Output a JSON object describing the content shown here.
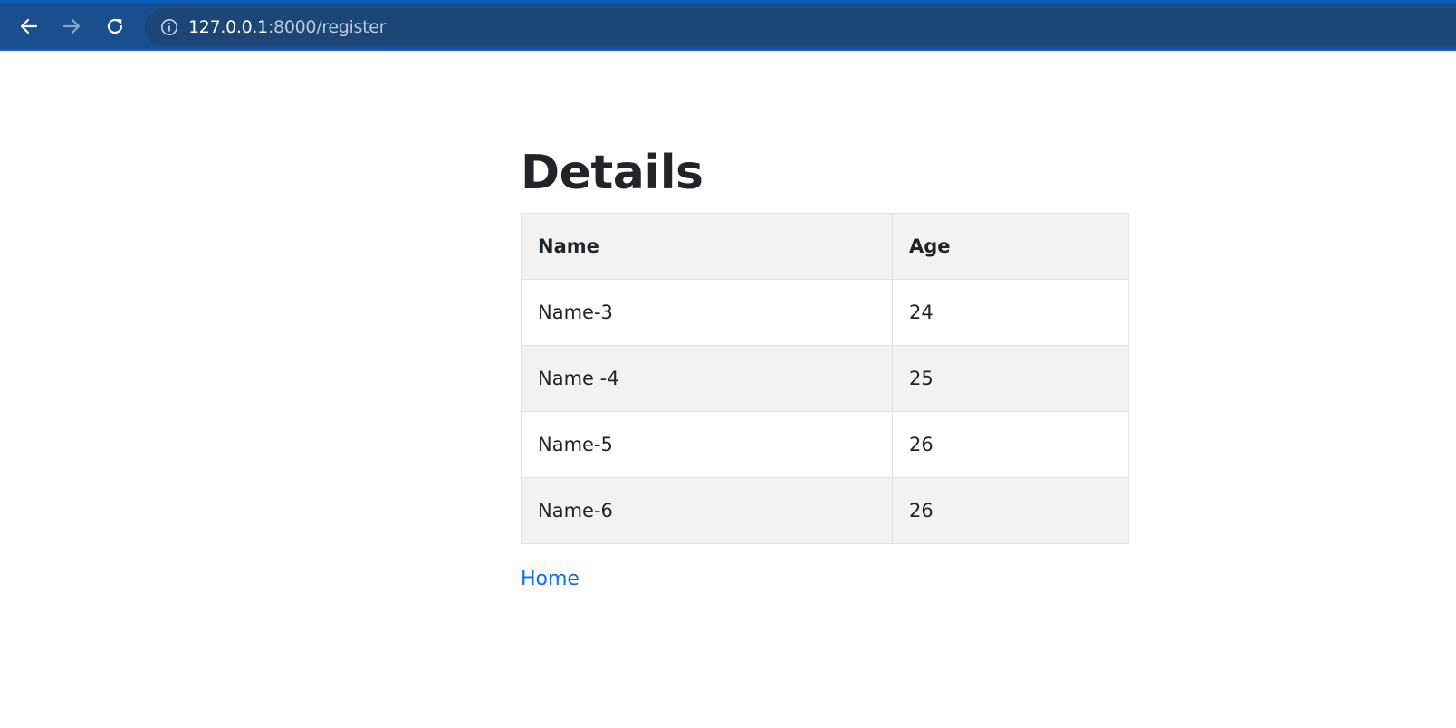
{
  "browser": {
    "url_host": "127.0.0.1",
    "url_path": ":8000/register",
    "icons": {
      "back": "arrow-left-icon",
      "forward": "arrow-right-icon",
      "reload": "reload-icon",
      "info": "info-icon"
    }
  },
  "page": {
    "title": "Details",
    "table": {
      "headers": [
        "Name",
        "Age"
      ],
      "rows": [
        {
          "name": "Name-3",
          "age": "24"
        },
        {
          "name": "Name -4",
          "age": "25"
        },
        {
          "name": "Name-5",
          "age": "26"
        },
        {
          "name": "Name-6",
          "age": "26"
        }
      ]
    },
    "home_link": "Home"
  },
  "colors": {
    "browser_bar": "#1a4f8f",
    "address_bar": "#1c4676",
    "link": "#0d6efd",
    "text": "#212529",
    "stripe": "#f2f2f2",
    "border": "#dee2e6"
  }
}
